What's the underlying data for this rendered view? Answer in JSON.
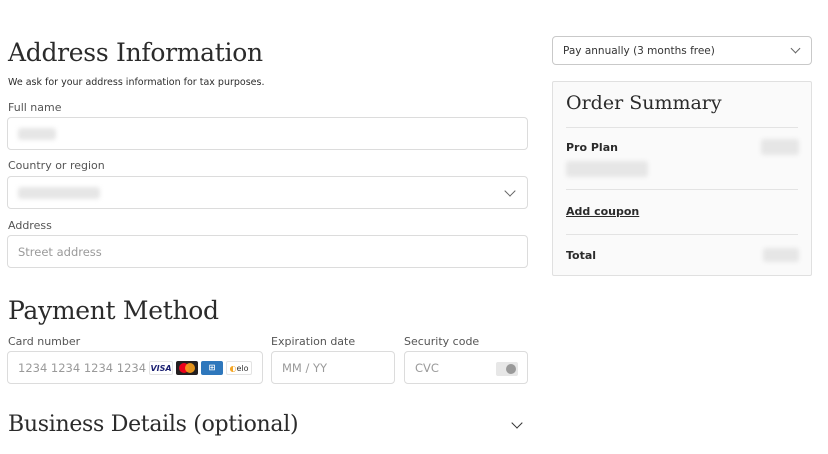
{
  "address": {
    "heading": "Address Information",
    "subtext": "We ask for your address information for tax purposes.",
    "full_name_label": "Full name",
    "country_label": "Country or region",
    "address_label": "Address",
    "address_placeholder": "Street address"
  },
  "payment": {
    "heading": "Payment Method",
    "card_number_label": "Card number",
    "card_number_placeholder": "1234 1234 1234 1234",
    "expiration_label": "Expiration date",
    "expiration_placeholder": "MM / YY",
    "security_label": "Security code",
    "security_placeholder": "CVC",
    "card_brands": [
      "VISA",
      "Mastercard",
      "Amex",
      "elo"
    ]
  },
  "business": {
    "heading": "Business Details (optional)"
  },
  "billing": {
    "selected_option": "Pay annually (3 months free)"
  },
  "summary": {
    "heading": "Order Summary",
    "plan_name": "Pro Plan",
    "coupon_link": "Add coupon",
    "total_label": "Total"
  },
  "colors": {
    "border": "#dcdcdc",
    "text": "#2b2b2b",
    "placeholder": "#9a9a9a",
    "visa_blue": "#1a1f71",
    "mastercard_red": "#eb001b",
    "mastercard_orange": "#f79e1b",
    "amex_blue": "#2e77bc"
  }
}
